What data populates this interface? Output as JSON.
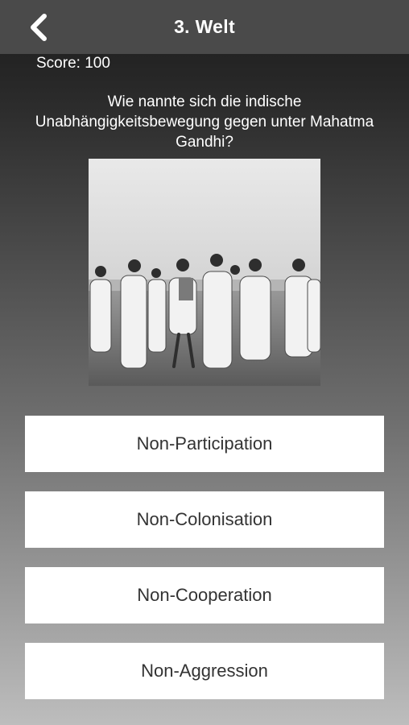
{
  "header": {
    "title": "3. Welt",
    "back_icon": "chevron-left-icon"
  },
  "score": {
    "text": "Score: 100"
  },
  "question": {
    "text": "Wie nannte sich die indische Unabhängigkeitsbewegung gegen unter Mahatma Gandhi?"
  },
  "photo": {
    "subject": "gandhi-salt-march-photo"
  },
  "answers": [
    {
      "label": "Non-Participation"
    },
    {
      "label": "Non-Colonisation"
    },
    {
      "label": "Non-Cooperation"
    },
    {
      "label": "Non-Aggression"
    }
  ]
}
